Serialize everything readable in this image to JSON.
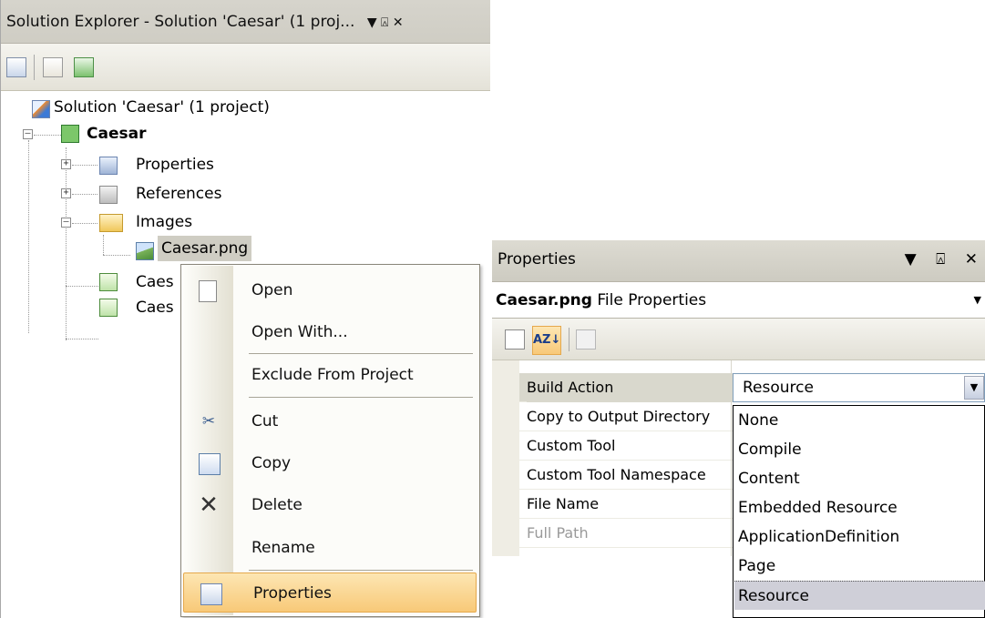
{
  "solution_explorer": {
    "title": "Solution Explorer - Solution 'Caesar' (1 proj...",
    "title_controls": "▼ ⬇",
    "tree": {
      "solution_label": "Solution 'Caesar' (1 project)",
      "project_label": "Caesar",
      "properties_label": "Properties",
      "references_label": "References",
      "images_label": "Images",
      "image_file_label": "Caesar.png",
      "file1_label": "Caes",
      "file2_label": "Caes"
    }
  },
  "context_menu": {
    "items": {
      "open": "Open",
      "open_with": "Open With...",
      "exclude": "Exclude From Project",
      "cut": "Cut",
      "copy": "Copy",
      "delete": "Delete",
      "rename": "Rename",
      "properties": "Properties"
    }
  },
  "properties_window": {
    "title": "Properties",
    "title_controls": "▾ ⬇ ✕",
    "object_name": "Caesar.png",
    "object_type": "File Properties",
    "toolbar": {
      "sort_label": "AZ↓"
    },
    "rows": [
      {
        "name": "Build Action",
        "value": "Resource"
      },
      {
        "name": "Copy to Output Directory",
        "value": ""
      },
      {
        "name": "Custom Tool",
        "value": ""
      },
      {
        "name": "Custom Tool Namespace",
        "value": ""
      },
      {
        "name": "File Name",
        "value": ""
      },
      {
        "name": "Full Path",
        "value": ""
      }
    ],
    "dropdown_options": [
      "None",
      "Compile",
      "Content",
      "Embedded Resource",
      "ApplicationDefinition",
      "Page",
      "Resource"
    ],
    "selected_option": "Resource"
  },
  "colors": {
    "highlight": "#f8c978",
    "selection": "#cfcfd8",
    "titlebar": "#d6d4cc"
  }
}
